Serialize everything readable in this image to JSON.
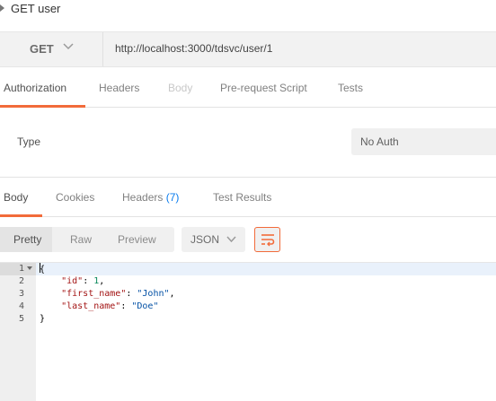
{
  "request": {
    "title": "GET user",
    "method": "GET",
    "url": "http://localhost:3000/tdsvc/user/1"
  },
  "request_tabs": [
    {
      "label": "Authorization",
      "state": "active"
    },
    {
      "label": "Headers",
      "state": "normal"
    },
    {
      "label": "Body",
      "state": "disabled"
    },
    {
      "label": "Pre-request Script",
      "state": "normal"
    },
    {
      "label": "Tests",
      "state": "normal"
    }
  ],
  "auth": {
    "type_label": "Type",
    "selected": "No Auth"
  },
  "response_tabs": {
    "body": "Body",
    "cookies": "Cookies",
    "headers": "Headers",
    "headers_count": "(7)",
    "test_results": "Test Results"
  },
  "response_toolbar": {
    "view_modes": [
      "Pretty",
      "Raw",
      "Preview"
    ],
    "active_view": "Pretty",
    "format": "JSON"
  },
  "response_body": {
    "line_numbers": [
      "1",
      "2",
      "3",
      "4",
      "5"
    ],
    "open_brace": "{",
    "close_brace": "}",
    "fields": [
      {
        "key": "\"id\"",
        "value": "1",
        "value_type": "number",
        "trailing": ","
      },
      {
        "key": "\"first_name\"",
        "value": "\"John\"",
        "value_type": "string",
        "trailing": ","
      },
      {
        "key": "\"last_name\"",
        "value": "\"Doe\"",
        "value_type": "string",
        "trailing": ""
      }
    ]
  },
  "colors": {
    "accent": "#f26b3a",
    "count_blue": "#097bed",
    "json_key": "#a31515",
    "json_string": "#0451a5",
    "json_number": "#09885a"
  }
}
